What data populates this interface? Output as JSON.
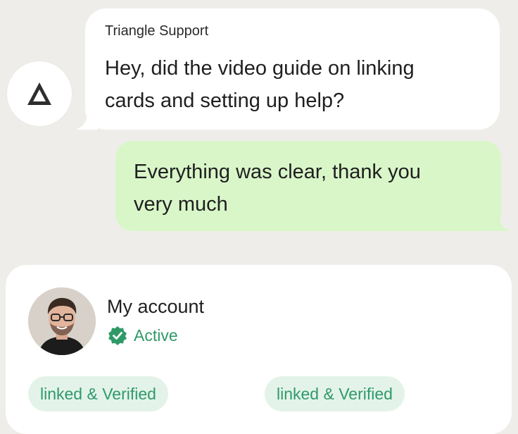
{
  "chat": {
    "incoming": {
      "sender": "Triangle Support",
      "line1": "Hey, did the video guide on linking",
      "line2": "cards and setting up help?"
    },
    "outgoing": {
      "line1": "Everything was clear, thank you",
      "line2": "very much"
    }
  },
  "account": {
    "title": "My account",
    "status": "Active",
    "badges": [
      "linked & Verified",
      "linked & Verified"
    ]
  },
  "colors": {
    "background": "#efede9",
    "incoming_bubble": "#ffffff",
    "outgoing_bubble": "#d9f6c9",
    "accent_green": "#2f9a68",
    "badge_bg": "#e4f3ea"
  },
  "icons": {
    "bot_avatar": "triangle-logo-icon",
    "status": "verified-check-icon"
  }
}
